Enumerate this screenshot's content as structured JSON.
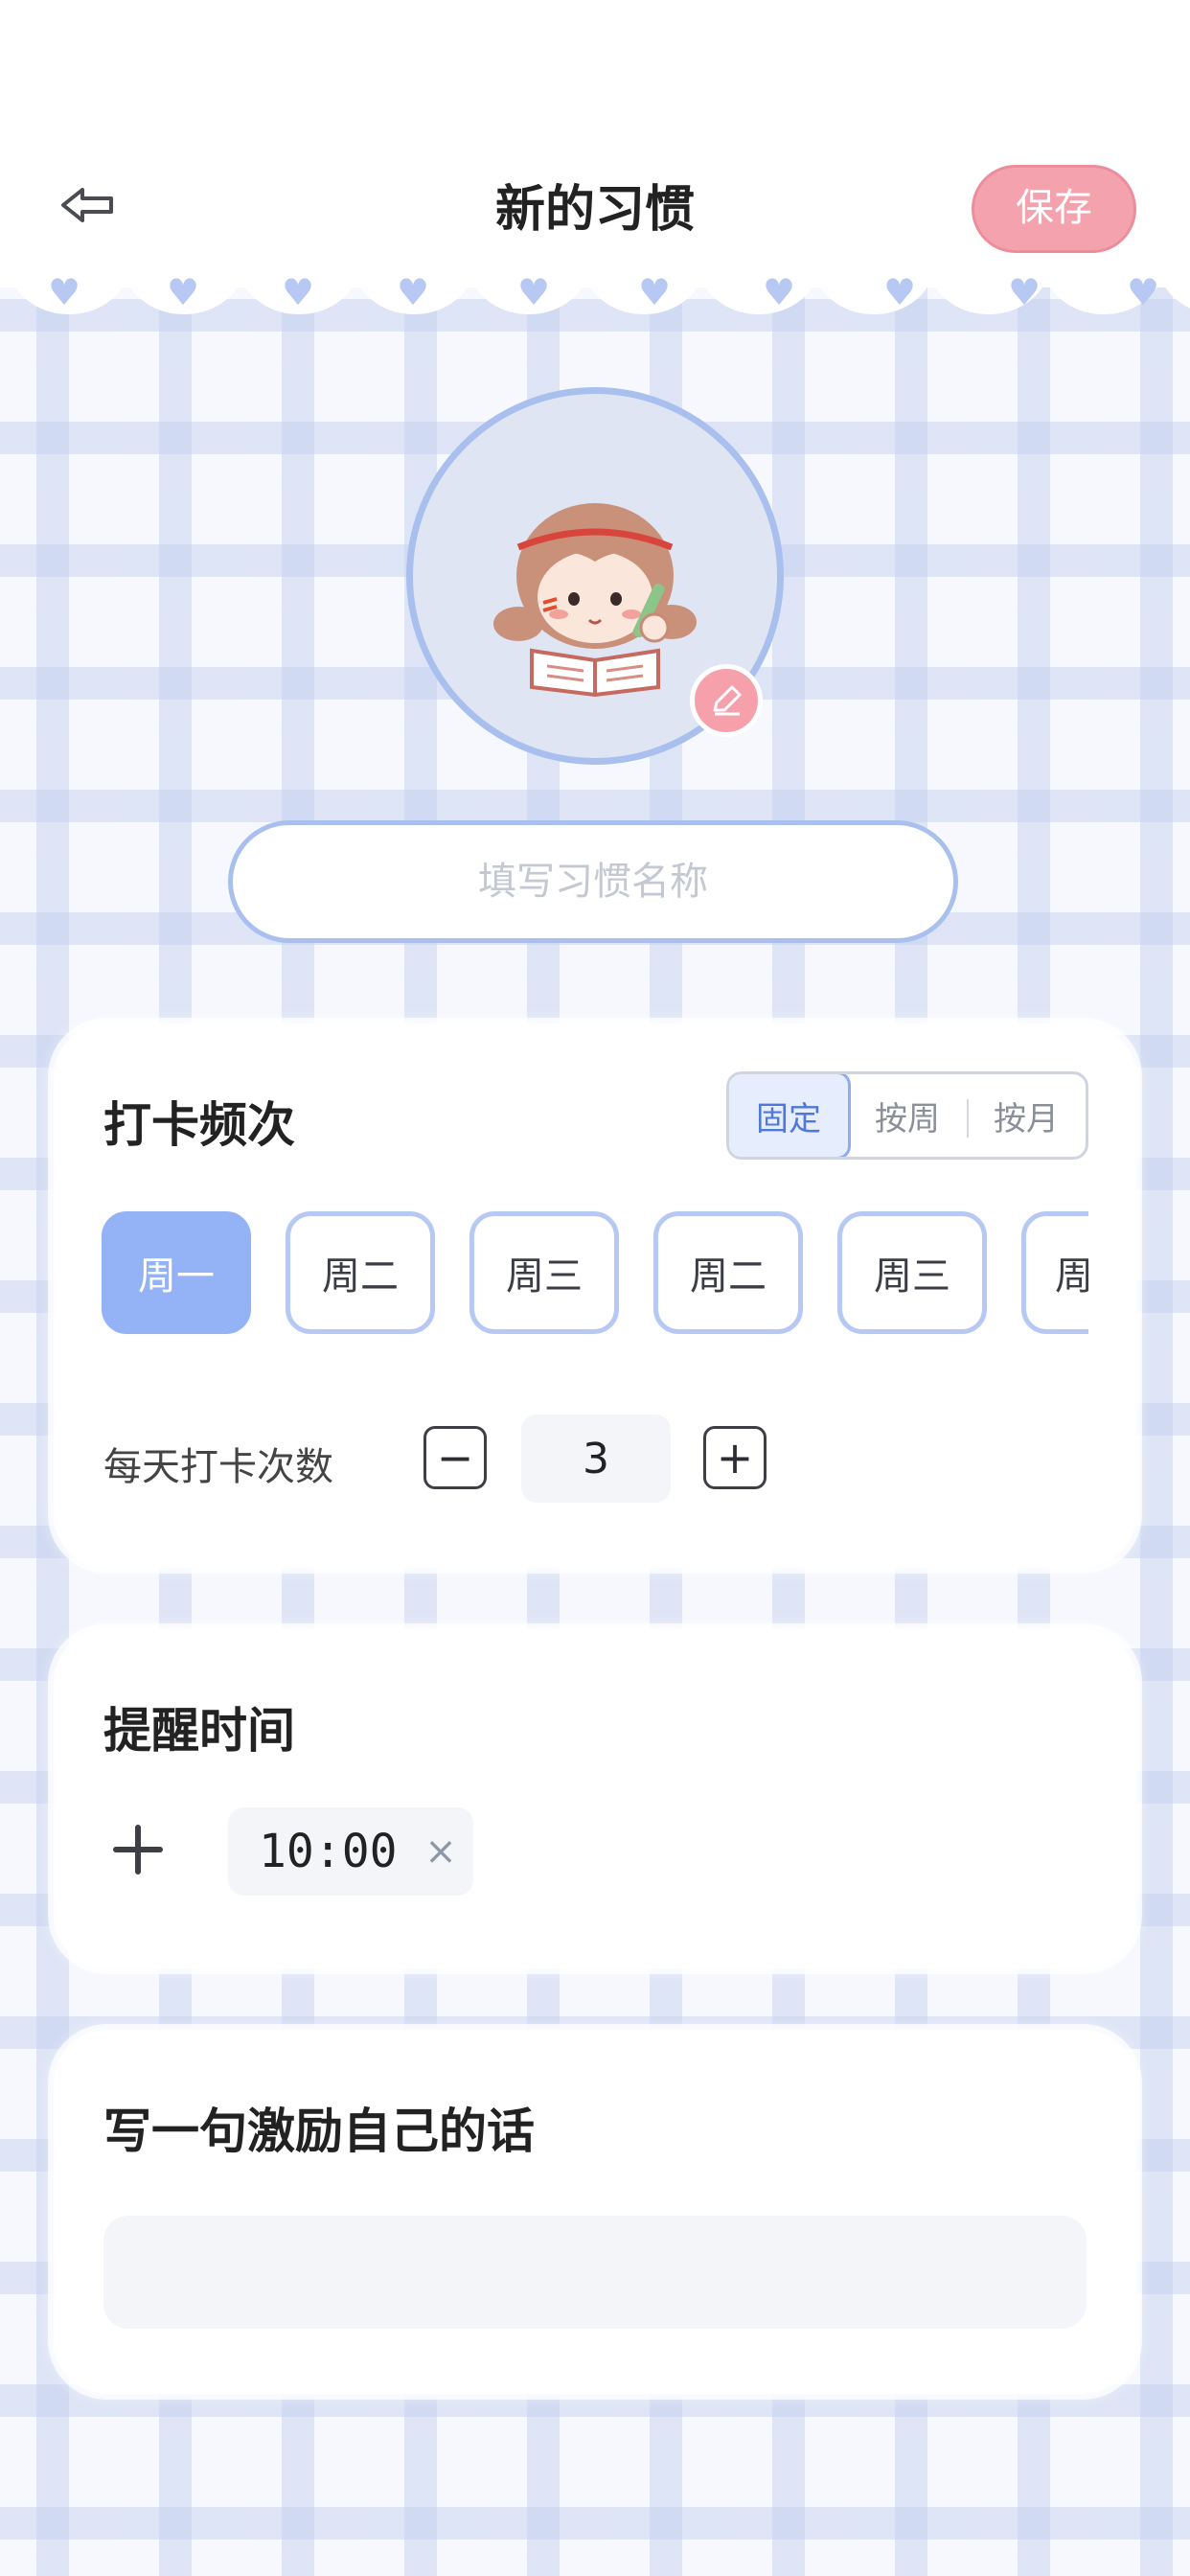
{
  "header": {
    "title": "新的习惯",
    "save_label": "保存",
    "back_icon": "back-arrow-icon"
  },
  "avatar": {
    "edit_icon": "pencil-icon"
  },
  "name_field": {
    "placeholder": "填写习惯名称",
    "value": ""
  },
  "frequency": {
    "title": "打卡频次",
    "modes": [
      "固定",
      "按周",
      "按月"
    ],
    "active_mode": "固定",
    "days": [
      {
        "label": "周一",
        "selected": true
      },
      {
        "label": "周二",
        "selected": false
      },
      {
        "label": "周三",
        "selected": false
      },
      {
        "label": "周二",
        "selected": false
      },
      {
        "label": "周三",
        "selected": false
      },
      {
        "label": "周",
        "selected": false
      }
    ],
    "count_label": "每天打卡次数",
    "count_value": "3",
    "minus_symbol": "−",
    "plus_symbol": "+"
  },
  "reminder": {
    "title": "提醒时间",
    "times": [
      "10:00"
    ],
    "remove_symbol": "×"
  },
  "motto": {
    "title": "写一句激励自己的话",
    "placeholder": "",
    "value": ""
  },
  "colors": {
    "accent_blue": "#93b3f6",
    "save_pink": "#f4a3ae",
    "border_blue": "#a9c0ee"
  }
}
